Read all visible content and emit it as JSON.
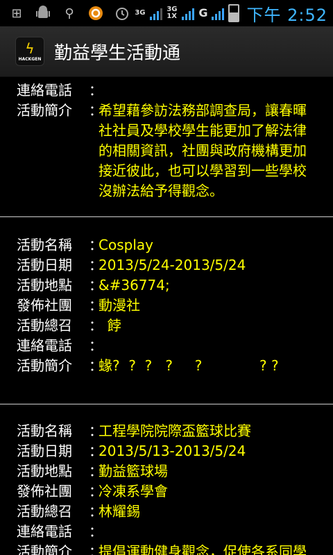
{
  "status_bar": {
    "net1": "3G",
    "net2_top": "3G",
    "net2_bottom": "1X",
    "carrier": "G",
    "time": "下午 2:52"
  },
  "app": {
    "title": "勤益學生活動通"
  },
  "block0": {
    "phone_label": "連絡電話",
    "phone_value": "",
    "intro_label": "活動簡介",
    "intro_value": "希望藉參訪法務部調查局，讓春暉社社員及學校學生能更加了解法律的相關資訊，社團與政府機構更加接近彼此，也可以學習到一些學校沒辦法給予得觀念。"
  },
  "block1": {
    "name_label": "活動名稱",
    "name_value": "Cosplay",
    "date_label": "活動日期",
    "date_value": "2013/5/24-2013/5/24",
    "place_label": "活動地點",
    "place_value": " &#36774;",
    "club_label": "發佈社團",
    "club_value": "動漫社",
    "lead_label": "活動總召",
    "lead_value": "  餑",
    "phone_label": "連絡電話",
    "phone_value": "",
    "intro_label": "活動簡介",
    "intro_value": "蝝?  ?  ?   ?     ?             ? ?"
  },
  "block2": {
    "name_label": "活動名稱",
    "name_value": "工程學院院際盃籃球比賽",
    "date_label": "活動日期",
    "date_value": "2013/5/13-2013/5/24",
    "place_label": "活動地點",
    "place_value": "勤益籃球場",
    "club_label": "發佈社團",
    "club_value": "冷凍系學會",
    "lead_label": "活動總召",
    "lead_value": "林耀錫",
    "phone_label": "連絡電話",
    "phone_value": "",
    "intro_label": "活動簡介",
    "intro_value": "提倡運動健身觀念，促使各系同學"
  },
  "colon": "："
}
